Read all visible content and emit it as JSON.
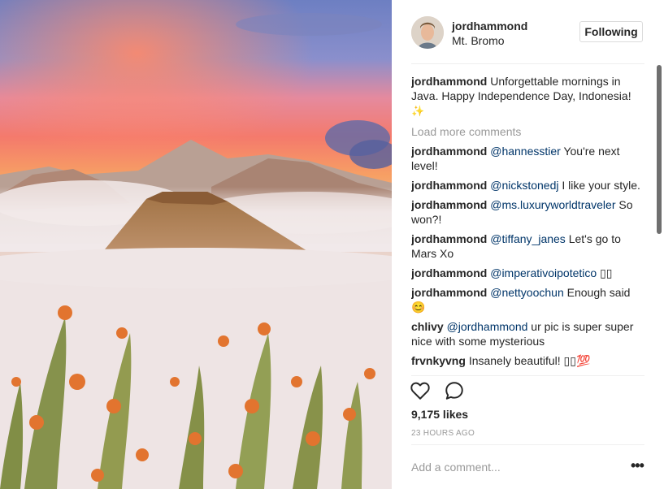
{
  "post": {
    "image_description_icon": "volcano-landscape-photo",
    "username": "jordhammond",
    "location": "Mt. Bromo",
    "follow_label": "Following"
  },
  "caption": {
    "user": "jordhammond",
    "text": "Unforgettable mornings in Java. Happy Independence Day, Indonesia!",
    "emoji": "✨"
  },
  "load_more_label": "Load more comments",
  "comments": [
    {
      "user": "jordhammond",
      "mention": "@hannesstier",
      "text": "You're next level!"
    },
    {
      "user": "jordhammond",
      "mention": "@nickstonedj",
      "text": "I like your style."
    },
    {
      "user": "jordhammond",
      "mention": "@ms.luxuryworldtraveler",
      "text": "So won?!"
    },
    {
      "user": "jordhammond",
      "mention": "@tiffany_janes",
      "text": "Let's go to Mars Xo"
    },
    {
      "user": "jordhammond",
      "mention": "@imperativoipotetico",
      "text": "▯▯"
    },
    {
      "user": "jordhammond",
      "mention": "@nettyoochun",
      "text": "Enough said 😊"
    },
    {
      "user": "chlivy",
      "mention": "@jordhammond",
      "text": "ur pic is super super nice with some mysterious"
    },
    {
      "user": "frvnkyvng",
      "mention": "",
      "text": "Insanely beautiful! ▯▯💯"
    }
  ],
  "actions": {
    "like_icon": "heart-icon",
    "comment_icon": "comment-bubble-icon"
  },
  "likes_label": "9,175 likes",
  "timestamp": "23 HOURS AGO",
  "add_comment_placeholder": "Add a comment...",
  "more_options_label": "•••",
  "colors": {
    "accent_mention": "#003569",
    "muted": "#999999",
    "text": "#262626",
    "border": "#dbdbdb"
  }
}
